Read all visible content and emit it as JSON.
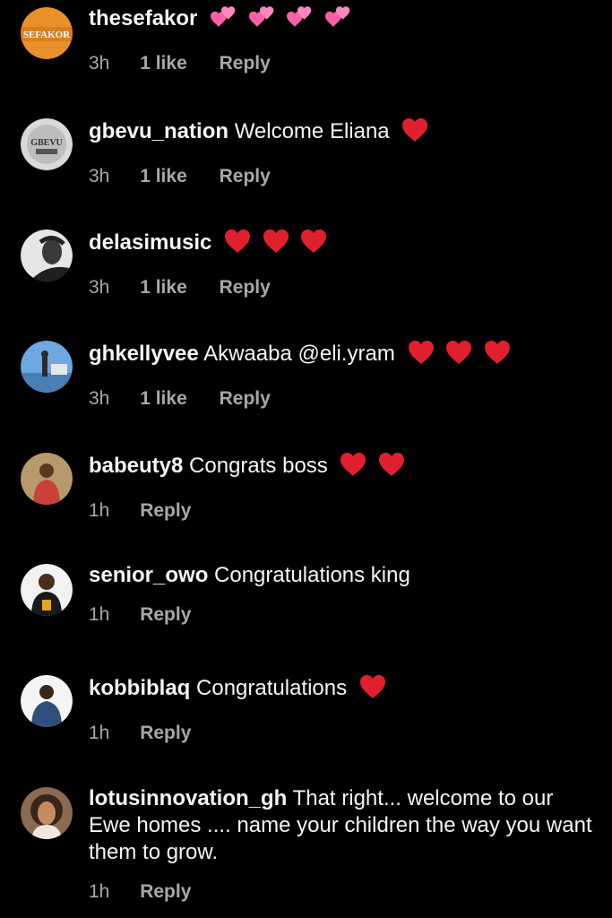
{
  "comments": [
    {
      "username": "thesefakor",
      "text": "",
      "time": "3h",
      "likes": "1 like",
      "reply": "Reply",
      "emoji": [
        "two-hearts",
        "two-hearts",
        "two-hearts",
        "two-hearts"
      ],
      "avatar_text": "SEFAKOR"
    },
    {
      "username": "gbevu_nation",
      "text": "Welcome Eliana",
      "time": "3h",
      "likes": "1 like",
      "reply": "Reply",
      "emoji": [
        "red-heart"
      ],
      "avatar_text": "GBEVU"
    },
    {
      "username": "delasimusic",
      "text": "",
      "time": "3h",
      "likes": "1 like",
      "reply": "Reply",
      "emoji": [
        "red-heart",
        "red-heart",
        "red-heart"
      ]
    },
    {
      "username": "ghkellyvee",
      "text": "Akwaaba @eli.yram",
      "time": "3h",
      "likes": "1 like",
      "reply": "Reply",
      "emoji": [
        "red-heart",
        "red-heart",
        "red-heart"
      ]
    },
    {
      "username": "babeuty8",
      "text": "Congrats boss",
      "time": "1h",
      "likes": "",
      "reply": "Reply",
      "emoji": [
        "red-heart",
        "red-heart"
      ]
    },
    {
      "username": "senior_owo",
      "text": "Congratulations king",
      "time": "1h",
      "likes": "",
      "reply": "Reply",
      "emoji": []
    },
    {
      "username": "kobbiblaq",
      "text": "Congratulations",
      "time": "1h",
      "likes": "",
      "reply": "Reply",
      "emoji": [
        "red-heart"
      ]
    },
    {
      "username": "lotusinnovation_gh",
      "text": "That right... welcome to our Ewe homes .... name your children the way you want them to grow.",
      "time": "1h",
      "likes": "",
      "reply": "Reply",
      "emoji": []
    }
  ],
  "colors": {
    "background": "#000000",
    "text": "#f5f5f5",
    "meta": "#a8a8a8",
    "red_heart": "#e0202e",
    "two_hearts": "#ff5fa8"
  }
}
